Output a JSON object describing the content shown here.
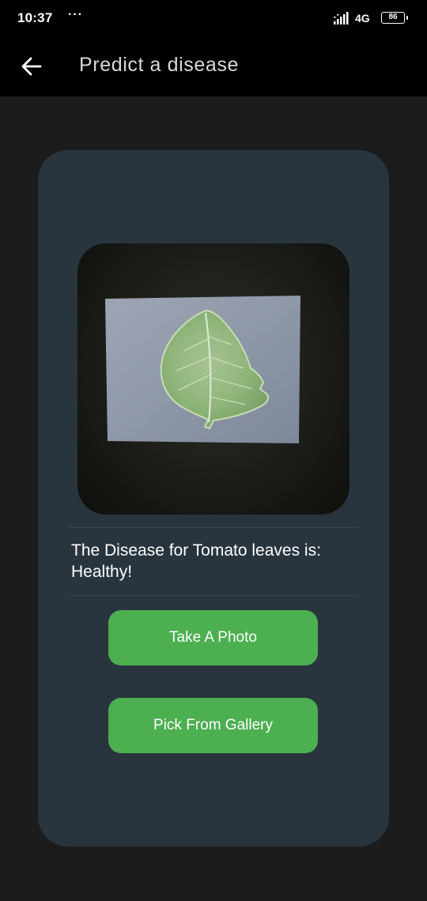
{
  "status_bar": {
    "time": "10:37",
    "dots": "···",
    "network": "4G",
    "battery": "86"
  },
  "app_bar": {
    "title": "Predict a disease",
    "back_icon": "arrow-left-icon"
  },
  "card": {
    "image": {
      "subject": "leaf-photo"
    },
    "result_line1": "The Disease for Tomato leaves is:",
    "result_line2": "Healthy!",
    "take_photo_label": "Take A Photo",
    "pick_gallery_label": "Pick From Gallery"
  },
  "colors": {
    "background": "#1c1c1c",
    "card": "#29353e",
    "accent": "#4caf50",
    "bar": "#000000"
  }
}
